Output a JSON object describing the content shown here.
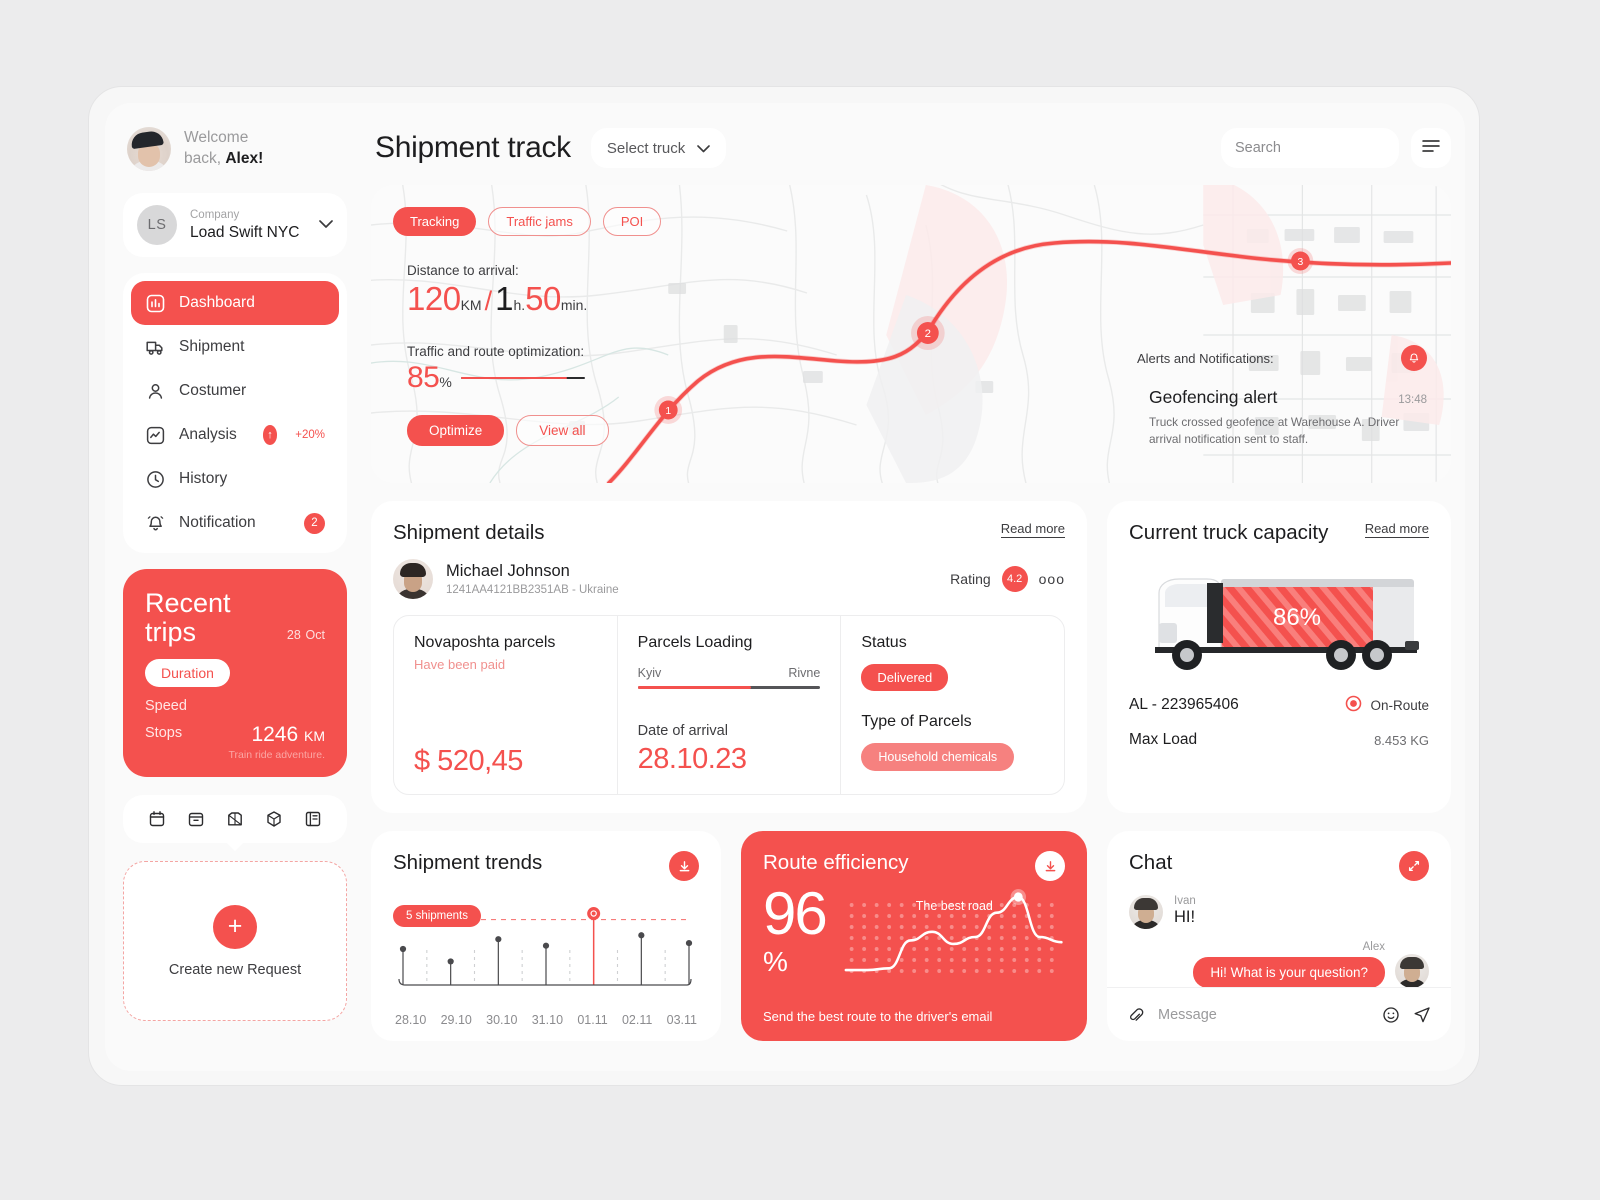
{
  "sidebar": {
    "welcome_line1": "Welcome",
    "welcome_line2_prefix": "back, ",
    "welcome_name": "Alex!",
    "company_label": "Company",
    "company_name": "Load Swift NYC",
    "company_initials": "LS",
    "nav": [
      {
        "label": "Dashboard",
        "icon": "dashboard-icon",
        "active": true
      },
      {
        "label": "Shipment",
        "icon": "truck-icon"
      },
      {
        "label": "Costumer",
        "icon": "user-icon"
      },
      {
        "label": "Analysis",
        "icon": "analytics-icon",
        "badge_up": "↑",
        "badge_pct": "+20%"
      },
      {
        "label": "History",
        "icon": "clock-icon"
      },
      {
        "label": "Notification",
        "icon": "bell-icon",
        "badge_num": "2"
      }
    ],
    "trips": {
      "title": "Recent trips",
      "date_num": "28",
      "date_month": "Oct",
      "tab_active": "Duration",
      "tab_speed": "Speed",
      "tab_stops": "Stops",
      "distance": "1246",
      "distance_unit": "KM",
      "caption": "Train ride adventure."
    },
    "quick_icons": [
      "calendar-icon",
      "archive-icon",
      "box-open-icon",
      "cube-icon",
      "book-icon"
    ],
    "create": {
      "plus": "+",
      "label": "Create new Request"
    }
  },
  "topbar": {
    "title": "Shipment track",
    "select_truck": "Select truck",
    "search_placeholder": "Search",
    "search_value": "",
    "menu": "menu-icon"
  },
  "map": {
    "pills": [
      {
        "label": "Tracking",
        "active": true
      },
      {
        "label": "Traffic jams",
        "active": false
      },
      {
        "label": "POI",
        "active": false
      }
    ],
    "distance_label": "Distance to arrival:",
    "distance_km": "120",
    "distance_km_unit": "KM",
    "slash": "/",
    "time_h": "1",
    "time_h_unit": "h.",
    "time_m": "50",
    "time_m_unit": "min.",
    "opt_label": "Traffic and route optimization:",
    "opt_pct": "85",
    "opt_pct_sym": "%",
    "opt_value": 85,
    "btn_optimize": "Optimize",
    "btn_viewall": "View all",
    "markers": [
      "1",
      "2",
      "3"
    ],
    "alerts": {
      "label": "Alerts and Notifications:",
      "title": "Geofencing alert",
      "time": "13:48",
      "body": "Truck crossed geofence at Warehouse A. Driver arrival notification sent to staff."
    }
  },
  "details": {
    "title": "Shipment details",
    "read_more": "Read more",
    "person_name": "Michael Johnson",
    "person_id": "1241AA4121BB2351AB - Ukraine",
    "rating_label": "Rating",
    "rating_value": "4.2",
    "more_dots": "ooo",
    "col1": {
      "title": "Novaposhta parcels",
      "sub": "Have been paid",
      "amount": "$ 520,45"
    },
    "col2": {
      "title": "Parcels Loading",
      "from": "Kyiv",
      "to": "Rivne",
      "progress": 62,
      "arrive_label": "Date of arrival",
      "arrive_value": "28.10.23"
    },
    "col3": {
      "title": "Status",
      "status": "Delivered",
      "type_label": "Type of Parcels",
      "type_value": "Household chemicals"
    }
  },
  "capacity": {
    "title": "Current truck capacity",
    "read_more": "Read more",
    "percent": "86%",
    "truck_id": "AL - 223965406",
    "status": "On-Route",
    "max_load_label": "Max Load",
    "max_load_value": "8.453 KG"
  },
  "trends": {
    "title": "Shipment trends",
    "download_icon": "download-icon",
    "threshold_chip": "5 shipments"
  },
  "route": {
    "title": "Route efficiency",
    "download_icon": "download-icon",
    "value": "96",
    "unit": "%",
    "annotation": "The best road",
    "footer": "Send the best route to the driver's email"
  },
  "chat": {
    "title": "Chat",
    "expand_icon": "expand-icon",
    "in_name": "Ivan",
    "in_text": "HI!",
    "out_name": "Alex",
    "out_text": "Hi! What is your question?",
    "input_placeholder": "Message",
    "attach_icon": "paperclip-icon",
    "emoji_icon": "smiley-icon",
    "send_icon": "send-icon"
  },
  "theme": {
    "accent": "#f4514e",
    "accent_soft": "#f6817f",
    "bg": "#fafafa",
    "text": "#1d1d1f"
  },
  "chart_data": [
    {
      "type": "bar",
      "title": "Shipment trends",
      "categories": [
        "28.10",
        "29.10",
        "30.10",
        "31.10",
        "01.11",
        "02.11",
        "03.11"
      ],
      "values": [
        5.5,
        3.6,
        7.0,
        6.0,
        10.0,
        7.6,
        6.4
      ],
      "threshold": 10,
      "threshold_label": "5 shipments",
      "highlight_index": 4,
      "ylim": [
        0,
        11
      ],
      "xlabel": "",
      "ylabel": "",
      "grid": false,
      "legend": "none"
    },
    {
      "type": "line",
      "title": "Route efficiency",
      "x": [
        0,
        1,
        2,
        3,
        4,
        5,
        6,
        7,
        8,
        9,
        10
      ],
      "values": [
        8,
        8,
        10,
        42,
        52,
        38,
        46,
        74,
        92,
        46,
        40
      ],
      "annotation": "The best road",
      "annotation_index": 8,
      "display_value": 96,
      "display_unit": "%",
      "ylim": [
        0,
        100
      ],
      "grid": false,
      "legend": "none"
    }
  ]
}
